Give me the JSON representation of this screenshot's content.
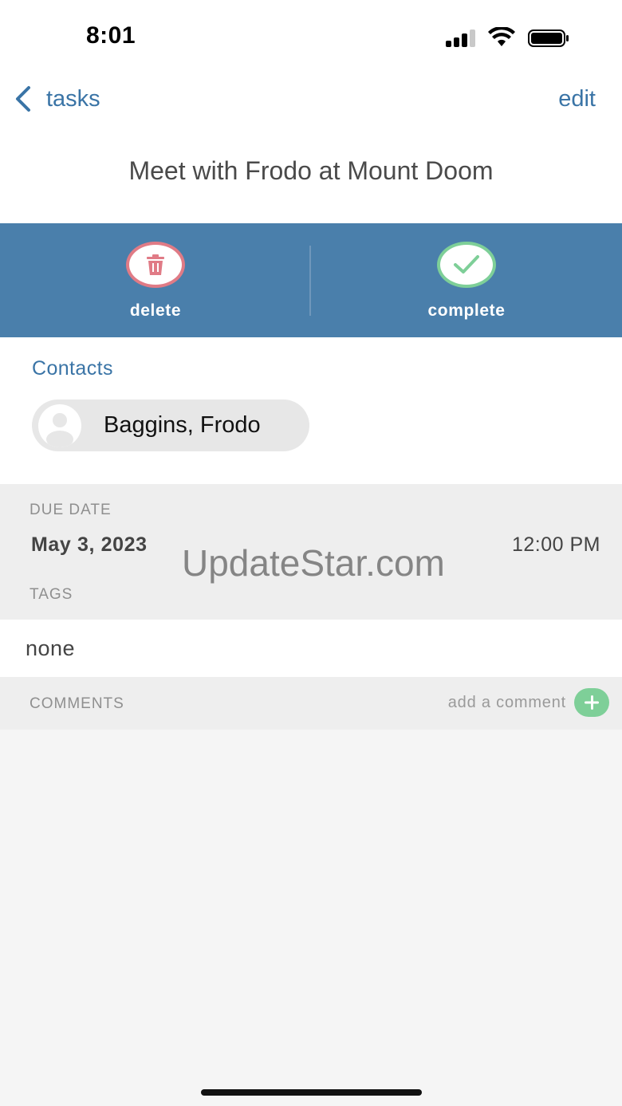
{
  "status_bar": {
    "time": "8:01"
  },
  "nav": {
    "back_label": "tasks",
    "edit_label": "edit"
  },
  "task": {
    "title": "Meet with Frodo at Mount Doom"
  },
  "actions": {
    "delete_label": "delete",
    "complete_label": "complete",
    "colors": {
      "bar": "#4a7fab",
      "delete": "#e07b86",
      "complete": "#7ecf98"
    }
  },
  "contacts": {
    "section_title": "Contacts",
    "items": [
      {
        "name": "Baggins, Frodo"
      }
    ]
  },
  "details": {
    "due_date_caption": "DUE DATE",
    "due_date": "May 3, 2023",
    "due_time": "12:00 PM",
    "tags_caption": "TAGS",
    "tags_value": "none"
  },
  "comments": {
    "caption": "COMMENTS",
    "add_label": "add a comment"
  },
  "watermark": "UpdateStar.com"
}
